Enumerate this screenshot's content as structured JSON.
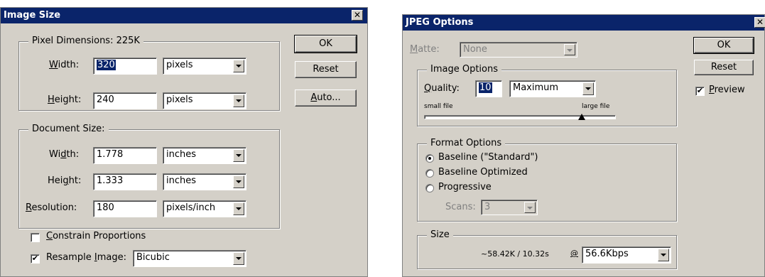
{
  "image_size": {
    "title": "Image Size",
    "close": "✕",
    "pixel_dimensions": {
      "legend": "Pixel Dimensions:  225K",
      "width_label": "Width:",
      "width_value": "320",
      "width_unit": "pixels",
      "height_label": "Height:",
      "height_value": "240",
      "height_unit": "pixels"
    },
    "document_size": {
      "legend": "Document Size:",
      "width_label": "Width:",
      "width_value": "1.778",
      "width_unit": "inches",
      "height_label": "Height:",
      "height_value": "1.333",
      "height_unit": "inches",
      "resolution_label": "Resolution:",
      "resolution_value": "180",
      "resolution_unit": "pixels/inch"
    },
    "constrain_label": "Constrain Proportions",
    "constrain_checked": false,
    "resample_label": "Resample Image:",
    "resample_checked": true,
    "resample_value": "Bicubic",
    "buttons": {
      "ok": "OK",
      "reset": "Reset",
      "auto": "Auto..."
    }
  },
  "jpeg_options": {
    "title": "JPEG Options",
    "close": "✕",
    "matte_label": "Matte:",
    "matte_value": "None",
    "image_options": {
      "legend": "Image Options",
      "quality_label": "Quality:",
      "quality_value": "10",
      "quality_preset": "Maximum",
      "small_file": "small file",
      "large_file": "large file",
      "slider_value": 0.83
    },
    "format_options": {
      "legend": "Format Options",
      "baseline_standard": "Baseline (\"Standard\")",
      "baseline_optimized": "Baseline Optimized",
      "progressive": "Progressive",
      "selected": "baseline_standard",
      "scans_label": "Scans:",
      "scans_value": "3"
    },
    "size": {
      "legend": "Size",
      "estimate": "~58.42K / 10.32s",
      "at": "@",
      "speed": "56.6Kbps"
    },
    "buttons": {
      "ok": "OK",
      "reset": "Reset"
    },
    "preview_label": "Preview",
    "preview_checked": true
  }
}
